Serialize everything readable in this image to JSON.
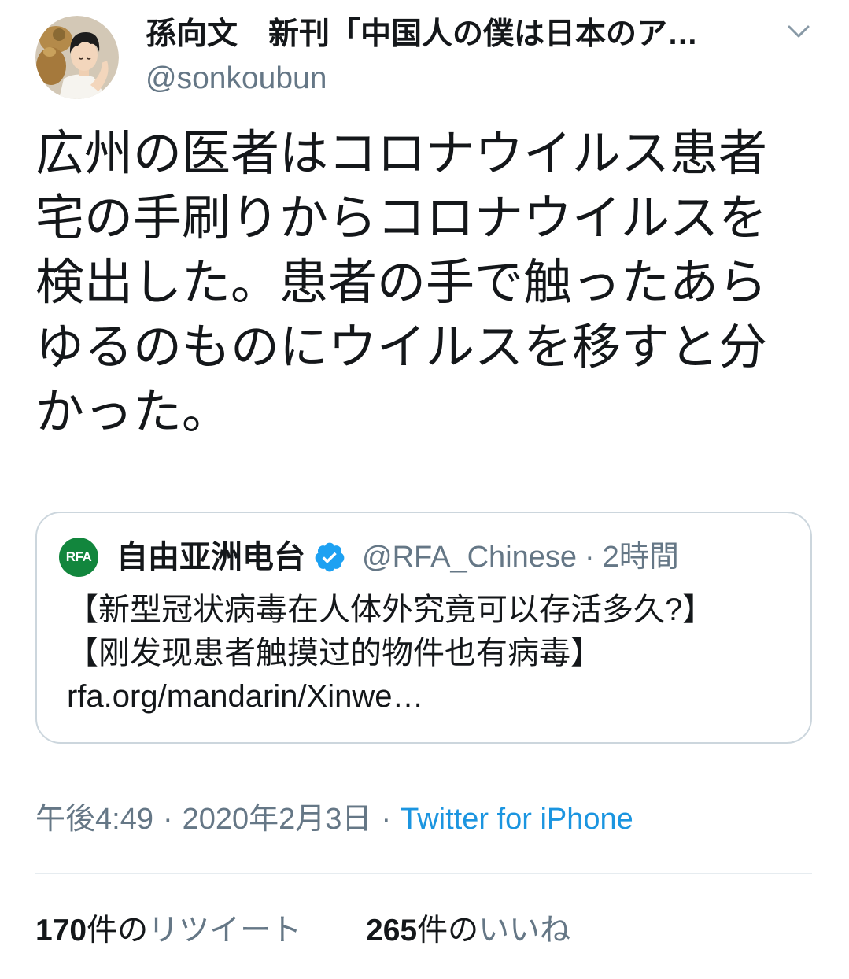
{
  "tweet": {
    "author": {
      "display_name": "孫向文　新刊「中国人の僕は日本のア…",
      "handle": "@sonkoubun",
      "avatar_icon": "avatar-illustration"
    },
    "menu_icon": "chevron-down-icon",
    "text": "広州の医者はコロナウイルス患者宅の手刷りからコロナウイルスを検出した。患者の手で触ったあらゆるのものにウイルスを移すと分かった。",
    "quoted_tweet": {
      "logo_text": "RFA",
      "display_name": "自由亚洲电台",
      "verified": true,
      "verified_icon": "verified-badge-icon",
      "handle": "@RFA_Chinese",
      "separator": "·",
      "time_ago": "2時間",
      "text_lines": [
        "【新型冠状病毒在人体外究竟可以存活多久?】",
        "【刚发现患者触摸过的物件也有病毒】",
        "rfa.org/mandarin/Xinwe…"
      ]
    },
    "meta": {
      "time": "午後4:49",
      "separator": "·",
      "date": "2020年2月3日",
      "source": "Twitter for iPhone"
    },
    "stats": {
      "retweets": {
        "count": "170",
        "unit": "件の",
        "label": "リツイート"
      },
      "likes": {
        "count": "265",
        "unit": "件の",
        "label": "いいね"
      }
    }
  },
  "colors": {
    "text": "#14171a",
    "secondary_text": "#657786",
    "link": "#1b95e0",
    "verified": "#1da1f2",
    "rfa_green": "#12863d",
    "card_border": "#ccd6dd",
    "divider": "#e6ecf0"
  }
}
